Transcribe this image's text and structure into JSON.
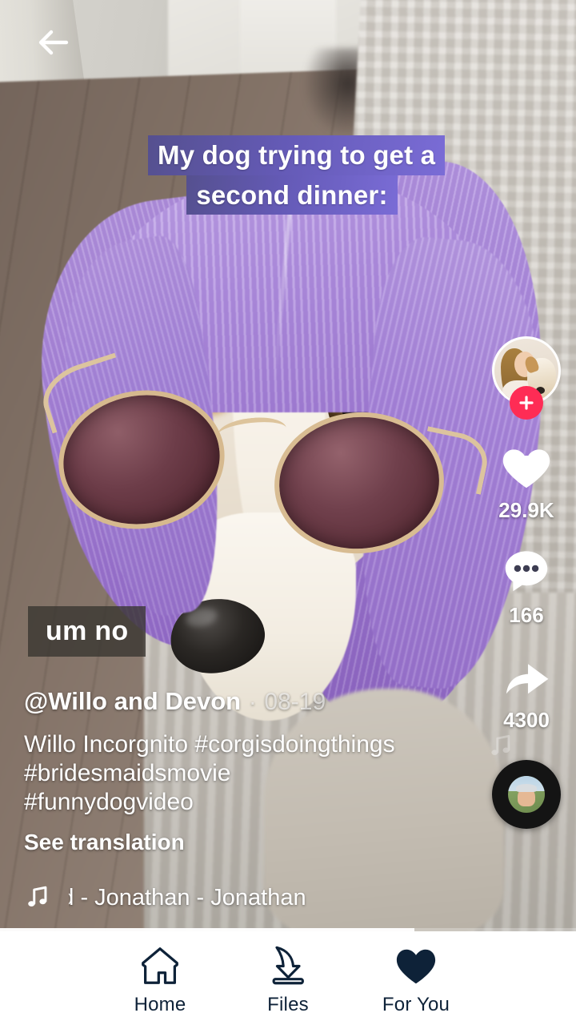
{
  "app": {
    "screen_name": "video-feed"
  },
  "topbar": {
    "back_icon": "back-arrow-icon"
  },
  "video": {
    "title_overlay": {
      "line1": "My dog trying to get a",
      "line2": "second dinner:",
      "background_color": "#655ab6",
      "text_color": "#ffffff"
    },
    "subtitle": "um no",
    "progress_percent": 72
  },
  "meta": {
    "username": "@Willo and Devon",
    "separator": "·",
    "date": "08-19",
    "description": "Willo Incorgnito #corgisdoingthings #bridesmaidsmovie #funnydogvideo",
    "see_translation": "See translation",
    "music_icon": "music-note-icon",
    "music_title": "und - Jonathan - Jonathan"
  },
  "rail": {
    "avatar": {
      "icon": "profile-avatar",
      "follow_icon": "plus-icon",
      "follow_color": "#fe2c55"
    },
    "actions": [
      {
        "icon": "heart-icon",
        "name": "like",
        "count": "29.9K"
      },
      {
        "icon": "comment-icon",
        "name": "comment",
        "count": "166"
      },
      {
        "icon": "share-icon",
        "name": "share",
        "count": "4300"
      }
    ],
    "disc": {
      "icon": "music-disc-icon",
      "note_icon": "music-note-icon"
    }
  },
  "bottom_nav": {
    "active_index": 2,
    "color": "#0e2238",
    "items": [
      {
        "label": "Home",
        "icon": "home-icon"
      },
      {
        "label": "Files",
        "icon": "download-icon"
      },
      {
        "label": "For You",
        "icon": "heart-filled-icon"
      }
    ]
  }
}
